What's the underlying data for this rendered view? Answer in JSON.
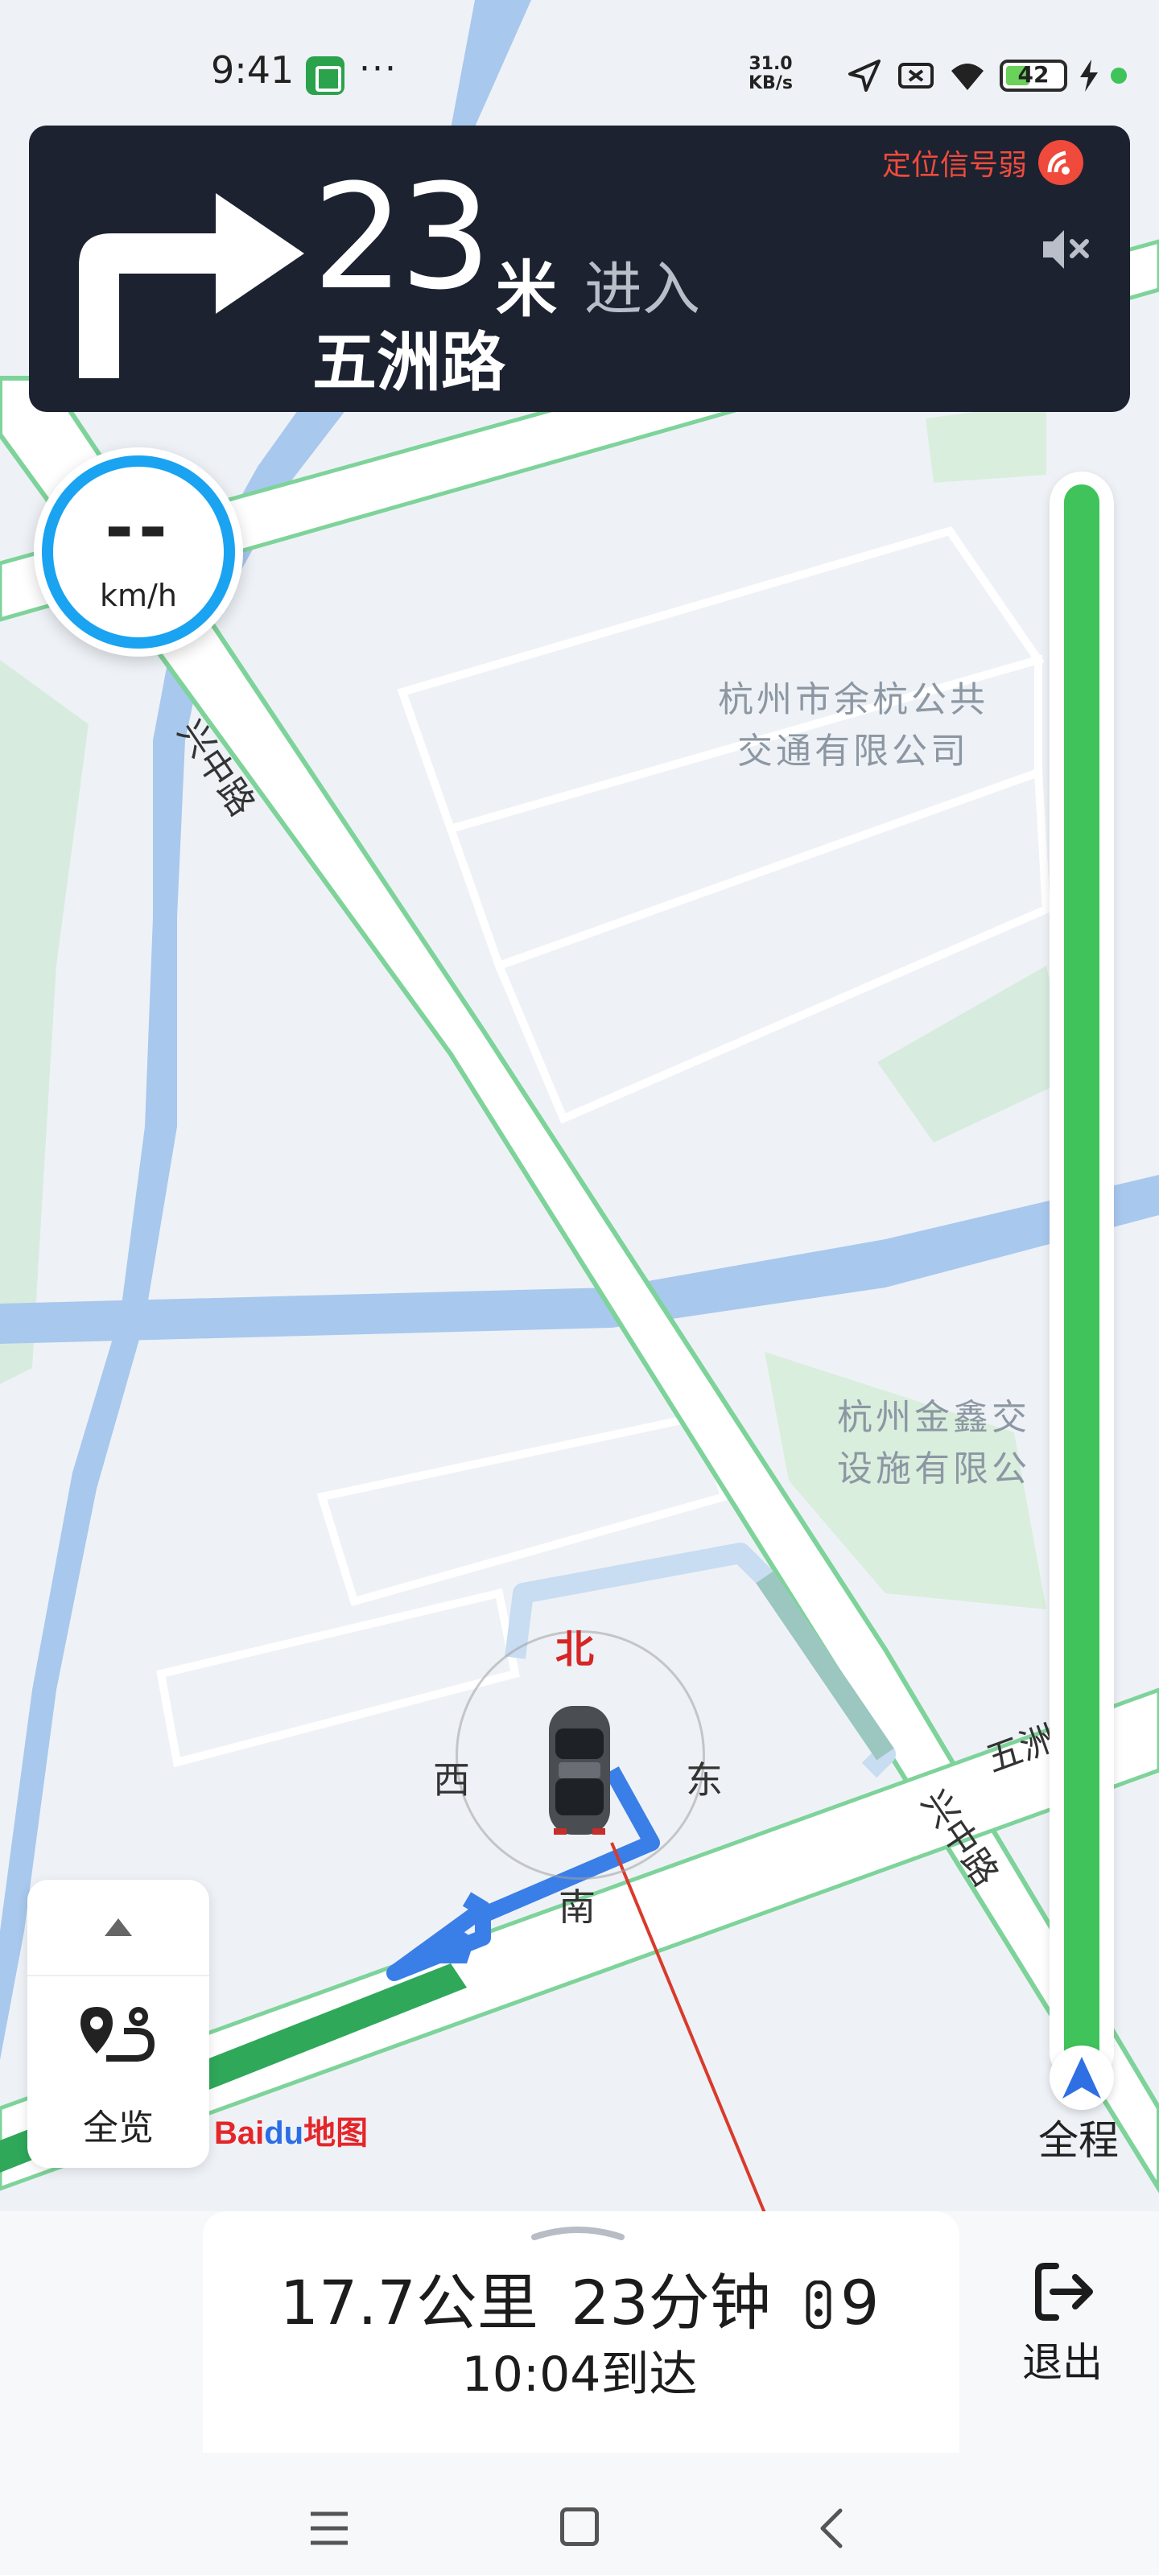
{
  "status_bar": {
    "time": "9:41",
    "more": "···",
    "net_speed_value": "31.0",
    "net_speed_unit": "KB/s",
    "battery_level": "42",
    "battery_fraction": 0.42,
    "icons": [
      "app-icon",
      "location-arrow-icon",
      "no-sim-icon",
      "wifi-icon",
      "battery-icon",
      "charging-icon"
    ]
  },
  "nav_banner": {
    "distance": "23",
    "distance_unit": "米",
    "action": "进入",
    "road": "五洲路",
    "gps_status": "定位信号弱",
    "turn_direction": "right",
    "bg_color": "#1c2230"
  },
  "speedometer": {
    "speed": "--",
    "unit": "km/h"
  },
  "map": {
    "labels": [
      {
        "text": "杭州市余杭公共\n交通有限公司"
      },
      {
        "text": "杭州金鑫交\n设施有限公"
      }
    ],
    "roads": [
      "兴中路",
      "兴中路",
      "五洲路"
    ],
    "compass": {
      "north": "北",
      "south": "南",
      "east": "东",
      "west": "西"
    }
  },
  "progress": {
    "label": "全程",
    "fraction_remaining": 1.0,
    "color": "#3fc35a"
  },
  "left_panel": {
    "overview_label": "全览"
  },
  "logo": {
    "bai": "Bai",
    "du": "du",
    "map": "地图"
  },
  "trip": {
    "distance": "17.7公里",
    "duration": "23分钟",
    "traffic_lights": "9",
    "arrival": "10:04到达"
  },
  "exit": {
    "label": "退出"
  },
  "system_nav": {
    "icons": [
      "menu-icon",
      "home-icon",
      "back-icon"
    ]
  }
}
